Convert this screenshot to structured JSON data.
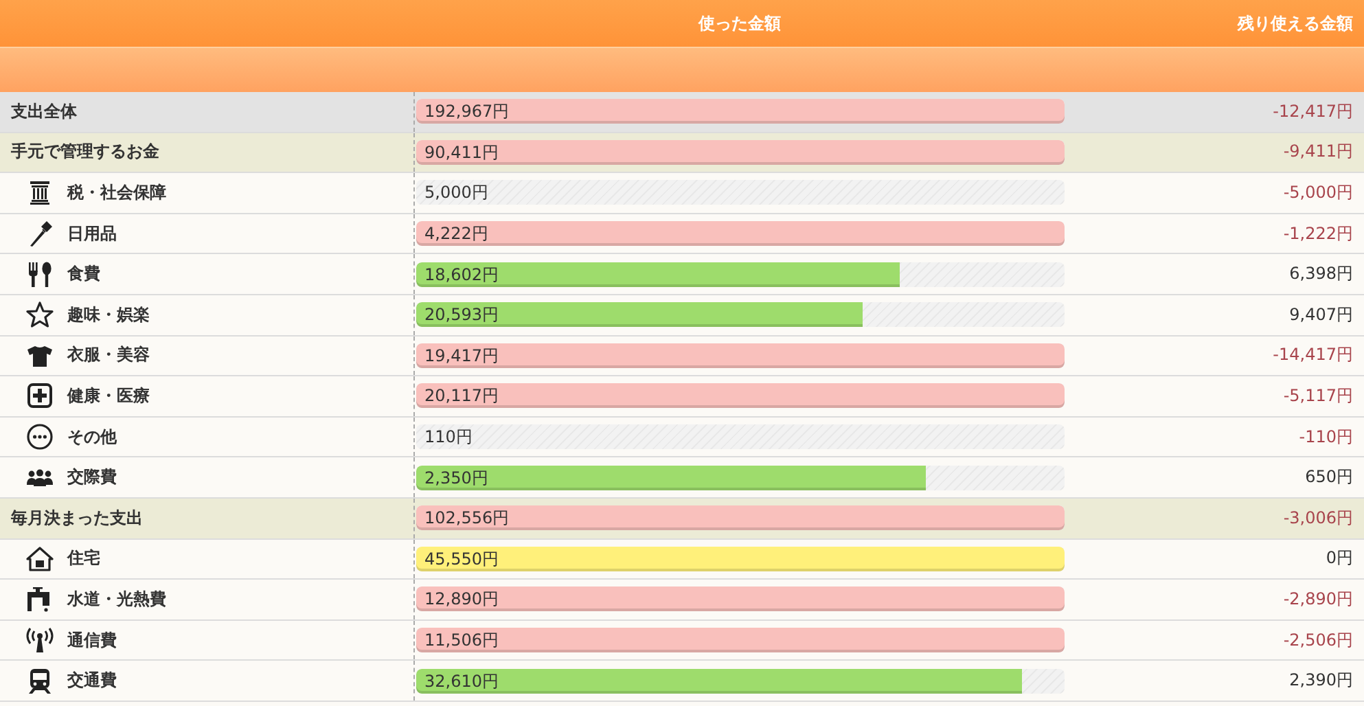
{
  "header": {
    "spent_heading": "使った金額",
    "remaining_heading": "残り使える金額"
  },
  "rows": [
    {
      "kind": "total",
      "label": "支出全体",
      "spent": "192,967円",
      "bar": {
        "color": "#f9c0bc",
        "level": 1
      },
      "remaining": "-12,417円",
      "overspent": true
    },
    {
      "kind": "group",
      "label": "手元で管理するお金",
      "spent": "90,411円",
      "bar": {
        "color": "#f9c0bc",
        "level": 1
      },
      "remaining": "-9,411円",
      "overspent": true
    },
    {
      "kind": "item",
      "label": "税・社会保障",
      "spent": "5,000円",
      "remaining": "-5,000円",
      "overspent": true
    },
    {
      "kind": "item",
      "label": "日用品",
      "spent": "4,222円",
      "bar": {
        "color": "#f9c0bc",
        "level": 1
      },
      "remaining": "-1,222円",
      "overspent": true
    },
    {
      "kind": "item",
      "label": "食費",
      "spent": "18,602円",
      "bar": {
        "color": "#9edc6c",
        "level": 0.746
      },
      "remaining": "6,398円",
      "overspent": false
    },
    {
      "kind": "item",
      "label": "趣味・娯楽",
      "spent": "20,593円",
      "bar": {
        "color": "#9edc6c",
        "level": 0.689
      },
      "remaining": "9,407円",
      "overspent": false
    },
    {
      "kind": "item",
      "label": "衣服・美容",
      "spent": "19,417円",
      "bar": {
        "color": "#f9c0bc",
        "level": 1
      },
      "remaining": "-14,417円",
      "overspent": true
    },
    {
      "kind": "item",
      "label": "健康・医療",
      "spent": "20,117円",
      "bar": {
        "color": "#f9c0bc",
        "level": 1
      },
      "remaining": "-5,117円",
      "overspent": true
    },
    {
      "kind": "item",
      "label": "その他",
      "spent": "110円",
      "remaining": "-110円",
      "overspent": true
    },
    {
      "kind": "item",
      "label": "交際費",
      "spent": "2,350円",
      "bar": {
        "color": "#9edc6c",
        "level": 0.786
      },
      "remaining": "650円",
      "overspent": false
    },
    {
      "kind": "group",
      "label": "毎月決まった支出",
      "spent": "102,556円",
      "bar": {
        "color": "#f9c0bc",
        "level": 1
      },
      "remaining": "-3,006円",
      "overspent": true
    },
    {
      "kind": "item",
      "label": "住宅",
      "spent": "45,550円",
      "bar": {
        "color": "#fff07a",
        "level": 1
      },
      "remaining": "0円",
      "overspent": false
    },
    {
      "kind": "item",
      "label": "水道・光熱費",
      "spent": "12,890円",
      "bar": {
        "color": "#f9c0bc",
        "level": 1
      },
      "remaining": "-2,890円",
      "overspent": true
    },
    {
      "kind": "item",
      "label": "通信費",
      "spent": "11,506円",
      "bar": {
        "color": "#f9c0bc",
        "level": 1
      },
      "remaining": "-2,506円",
      "overspent": true
    },
    {
      "kind": "item",
      "label": "交通費",
      "spent": "32,610円",
      "bar": {
        "color": "#9edc6c",
        "level": 0.934
      },
      "remaining": "2,390円",
      "overspent": false
    }
  ]
}
